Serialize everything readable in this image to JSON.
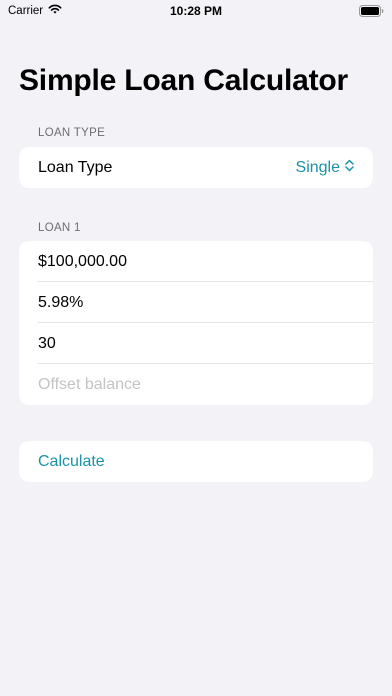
{
  "status_bar": {
    "carrier": "Carrier",
    "time": "10:28 PM"
  },
  "title": "Simple Loan Calculator",
  "loan_type_section": {
    "header": "LOAN TYPE",
    "row_label": "Loan Type",
    "selected_value": "Single"
  },
  "loan1_section": {
    "header": "LOAN 1",
    "fields": {
      "amount": "$100,000.00",
      "rate": "5.98%",
      "term": "30",
      "offset_placeholder": "Offset balance"
    }
  },
  "calculate_label": "Calculate",
  "colors": {
    "accent": "#1a93a8",
    "background": "#f2f2f7",
    "card": "#ffffff",
    "section_header": "#6d6d72",
    "placeholder": "#c4c4c7"
  },
  "icons": {
    "wifi": "wifi-icon",
    "battery": "battery-icon",
    "picker": "chevron-up-down-icon"
  }
}
